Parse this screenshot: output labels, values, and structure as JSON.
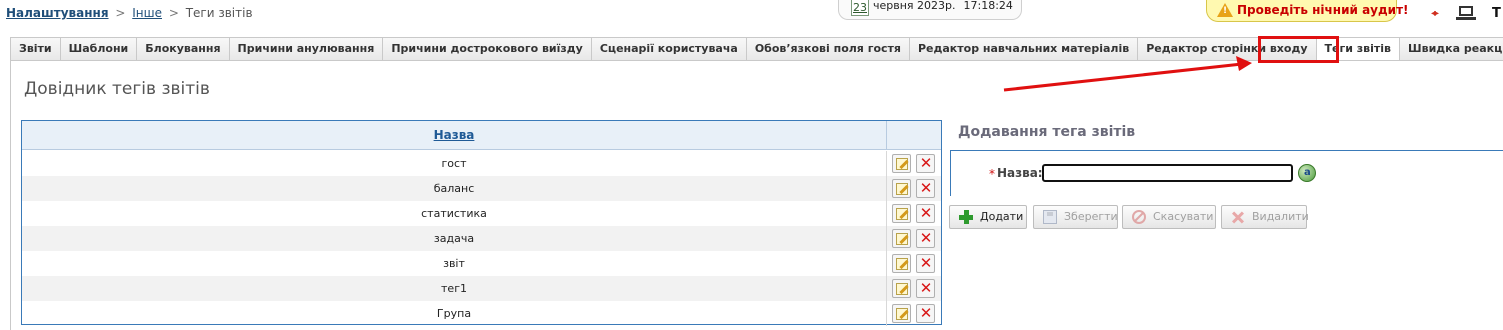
{
  "breadcrumb": {
    "root": "Налаштування",
    "separator": ">",
    "section": "Інше",
    "current": "Теги звітів"
  },
  "datetime": {
    "day": "23",
    "date": "червня 2023р.",
    "time": "17:18:24"
  },
  "audit_banner": {
    "text": "Проведіть нічний аудит!",
    "icon": "warning-icon"
  },
  "header_right": {
    "user_initial": "Т"
  },
  "tabs": [
    {
      "label": "Звіти",
      "active": false
    },
    {
      "label": "Шаблони",
      "active": false
    },
    {
      "label": "Блокування",
      "active": false
    },
    {
      "label": "Причини анулювання",
      "active": false
    },
    {
      "label": "Причини дострокового виїзду",
      "active": false
    },
    {
      "label": "Сценарії користувача",
      "active": false
    },
    {
      "label": "Обов’язкові поля гостя",
      "active": false
    },
    {
      "label": "Редактор навчальних матеріалів",
      "active": false
    },
    {
      "label": "Редактор сторінки входу",
      "active": false
    },
    {
      "label": "Теги звітів",
      "active": true
    },
    {
      "label": "Швидка реакція на події",
      "active": false
    }
  ],
  "page_title": "Довідник тегів звітів",
  "table": {
    "column_header": "Назва",
    "rows": [
      "гост",
      "баланс",
      "статистика",
      "задача",
      "звіт",
      "тег1",
      "Група"
    ]
  },
  "form": {
    "title": "Додавання тега звітів",
    "required_mark": "*",
    "name_label": "Назва:",
    "name_value": "",
    "buttons": {
      "add": "Додати",
      "save": "Зберегти",
      "cancel": "Скасувати",
      "delete": "Видалити"
    }
  },
  "colors": {
    "accent_blue": "#3a7ab8",
    "highlight_red": "#e01010",
    "audit_text": "#c80000",
    "audit_bg": "#fff9b0"
  }
}
